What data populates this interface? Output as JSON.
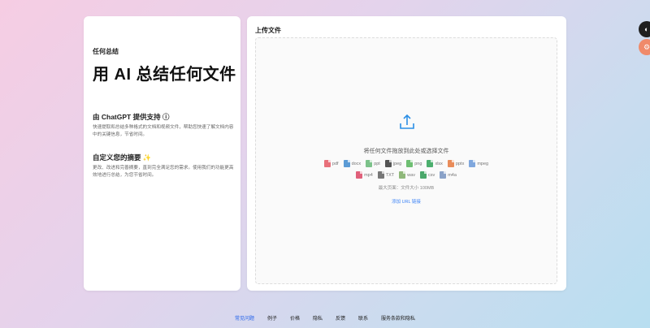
{
  "intro": {
    "eyebrow": "任何总结",
    "headline": "用 AI 总结任何文件",
    "sections": [
      {
        "title": "由 ChatGPT 提供支持 ⓘ",
        "body": "快速提取和总结多种格式的文档和视频文件，帮助您快速了解文档内容中的关键信息，节省时间。"
      },
      {
        "title": "自定义您的摘要 ✨",
        "body": "更改、改进和完善摘要，直到完全满足您的需求。使用我们的功能更高效地进行总结，为您节省时间。"
      }
    ]
  },
  "upload": {
    "title": "上传文件",
    "hint": "将任何文件拖放到此处或选择文件",
    "file_types_row1": [
      {
        "label": "pdf",
        "color": "#e8707a"
      },
      {
        "label": "docx",
        "color": "#5b9bd5"
      },
      {
        "label": "ppt",
        "color": "#7cc28a"
      },
      {
        "label": "jpeg",
        "color": "#555555"
      },
      {
        "label": "png",
        "color": "#6fbf73"
      },
      {
        "label": "xlsx",
        "color": "#4caf6e"
      },
      {
        "label": "pptx",
        "color": "#e98c5a"
      },
      {
        "label": "mpeg",
        "color": "#7fa7dd"
      }
    ],
    "file_types_row2": [
      {
        "label": "mp4",
        "color": "#e0607a"
      },
      {
        "label": "TXT",
        "color": "#777777"
      },
      {
        "label": "wav",
        "color": "#8fb87a"
      },
      {
        "label": "csv",
        "color": "#4aa86a"
      },
      {
        "label": "m4a",
        "color": "#8aa2c8"
      }
    ],
    "max_size": "最大页面：文件大小 100MB",
    "url_link": "添加 URL 链接"
  },
  "footer": {
    "links": [
      {
        "label": "常见问题",
        "active": true
      },
      {
        "label": "例子"
      },
      {
        "label": "价格"
      },
      {
        "label": "隐私"
      },
      {
        "label": "反馈"
      },
      {
        "label": "联系"
      },
      {
        "label": "服务条款和隐私"
      }
    ]
  },
  "colors": {
    "accent": "#2563eb",
    "link": "#3b82f6",
    "upload_icon": "#2b8fe6"
  }
}
